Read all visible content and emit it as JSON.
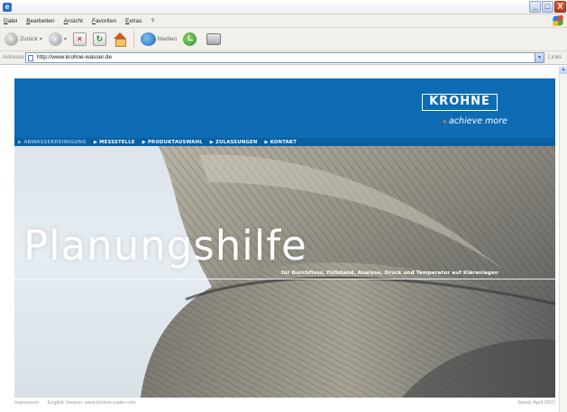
{
  "window": {
    "app_icon_letter": "e",
    "buttons": {
      "minimize": "_",
      "maximize": "□",
      "close": "X"
    }
  },
  "menu": [
    "Datei",
    "Bearbeiten",
    "Ansicht",
    "Favoriten",
    "Extras",
    "?"
  ],
  "toolbar": {
    "back_label": "Zurück",
    "media_label": "Medien",
    "icons": [
      "back-icon",
      "forward-icon",
      "stop-icon",
      "refresh-icon",
      "home-icon",
      "media-icon",
      "history-icon",
      "print-icon"
    ]
  },
  "addressbar": {
    "label": "Adresse",
    "url": "http://www.krohne-wasser.de",
    "links_label": "Links"
  },
  "site": {
    "logo": "KROHNE",
    "tagline_arrow": "▸",
    "tagline": "achieve more",
    "nav": [
      "▶ ABWASSERREINIGUNG",
      "▶ MESSSTELLE",
      "▶ PRODUKTAUSWAHL",
      "▶ ZULASSUNGEN",
      "▶ KONTAKT"
    ],
    "hero_title": "Planungshilfe",
    "hero_subtitle": "für Durchfluss, Füllstand, Analyse, Druck und Temperatur auf Kläranlagen",
    "footer_links": [
      "Impressum",
      "English Version: www.krohne-water.com"
    ],
    "footer_date": "Stand: April 2007"
  },
  "colors": {
    "brand_blue": "#0d6cb3",
    "nav_blue": "#0a5fa1",
    "accent_orange": "#f07a22",
    "active_nav": "#8fbde4"
  }
}
